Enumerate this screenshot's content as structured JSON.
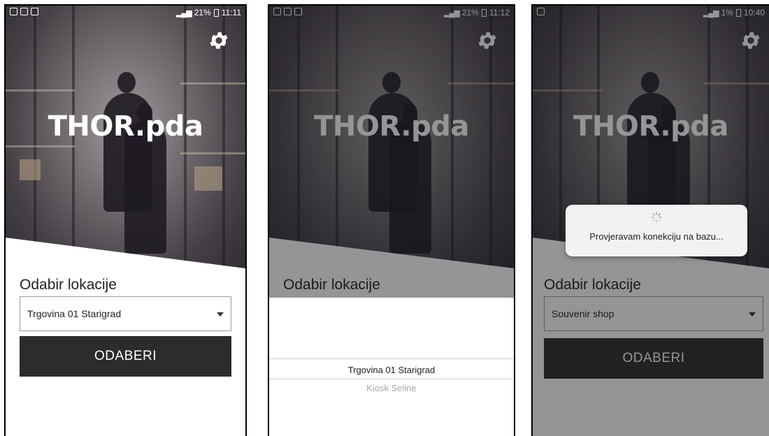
{
  "app": {
    "title": "THOR.pda"
  },
  "screens": [
    {
      "status": {
        "battery": "21%",
        "time": "11:11"
      },
      "location_label": "Odabir lokacije",
      "selected_location": "Trgovina 01 Starigrad",
      "button_label": "ODABERI"
    },
    {
      "status": {
        "battery": "21%",
        "time": "11:12"
      },
      "location_label": "Odabir lokacije",
      "picker_options": [
        "Trgovina 01 Starigrad",
        "Kiosk Seline"
      ]
    },
    {
      "status": {
        "battery": "1%",
        "time": "10:40"
      },
      "location_label": "Odabir lokacije",
      "selected_location": "Souvenir shop",
      "button_label": "ODABERI",
      "dialog_message": "Provjeravam konekciju na bazu..."
    }
  ],
  "colors": {
    "button_bg": "#2c2c2c",
    "title": "#ffffff",
    "overlay": "#141419"
  },
  "icons": [
    "gear-icon",
    "caret-down-icon",
    "spinner-icon",
    "signal-icon",
    "battery-icon"
  ]
}
